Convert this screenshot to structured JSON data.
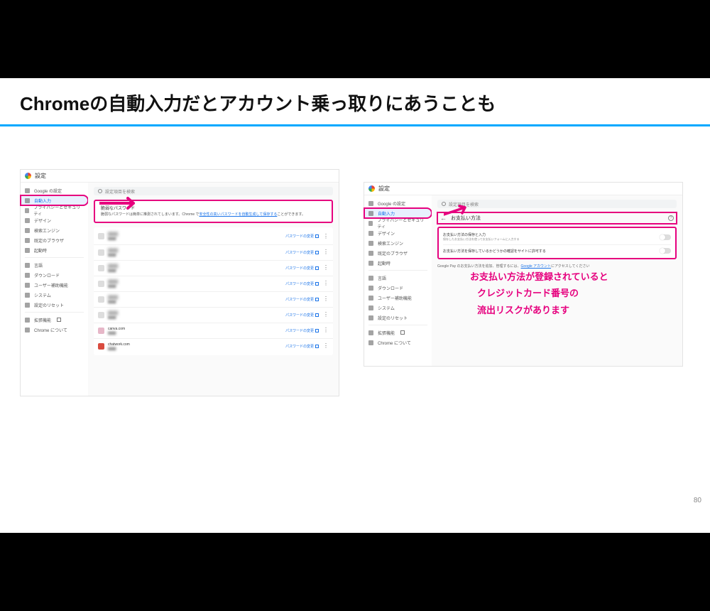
{
  "slide": {
    "title": "Chromeの自動入力だとアカウント乗っ取りにあうことも",
    "page_number": "80"
  },
  "callout": {
    "line1": "お支払い方法が登録されていると",
    "line2": "クレジットカード番号の",
    "line3": "流出リスクがあります"
  },
  "chrome": {
    "settings_label": "設定",
    "search_placeholder": "設定項目を検索",
    "sidebar": {
      "google": "Google の設定",
      "autofill": "自動入力",
      "privacy": "プライバシーとセキュリティ",
      "design": "デザイン",
      "search_engine": "検索エンジン",
      "default_browser": "既定のブラウザ",
      "startup": "起動時",
      "language": "言語",
      "download": "ダウンロード",
      "accessibility": "ユーザー補助機能",
      "system": "システム",
      "reset": "設定のリセット",
      "extensions": "拡張機能",
      "about": "Chrome について"
    }
  },
  "left_panel": {
    "warn_title": "脆弱なパスワード",
    "warn_text_1": "脆弱なパスワードは簡単に推測されてしまいます。Chrome で",
    "warn_link": "安全性の高いパスワードを自動生成して保存する",
    "warn_text_2": "ことができます。",
    "change_button": "パスワードの変更",
    "rows": {
      "canva": "canva.com",
      "chatwork": "chatwork.com"
    }
  },
  "right_panel": {
    "back_label": "お支払い方法",
    "row1_title": "お支払い方法の保存と入力",
    "row1_sub": "保存したお支払い方法を使ってお支払いフォームに入力する",
    "row2_title": "お支払い方法を保存しているかどうかの確認をサイトに許可する",
    "footer_1": "Google Pay のお支払い方法を追加、管理するには、",
    "footer_link": "Google アカウント",
    "footer_2": "にアクセスしてください"
  }
}
